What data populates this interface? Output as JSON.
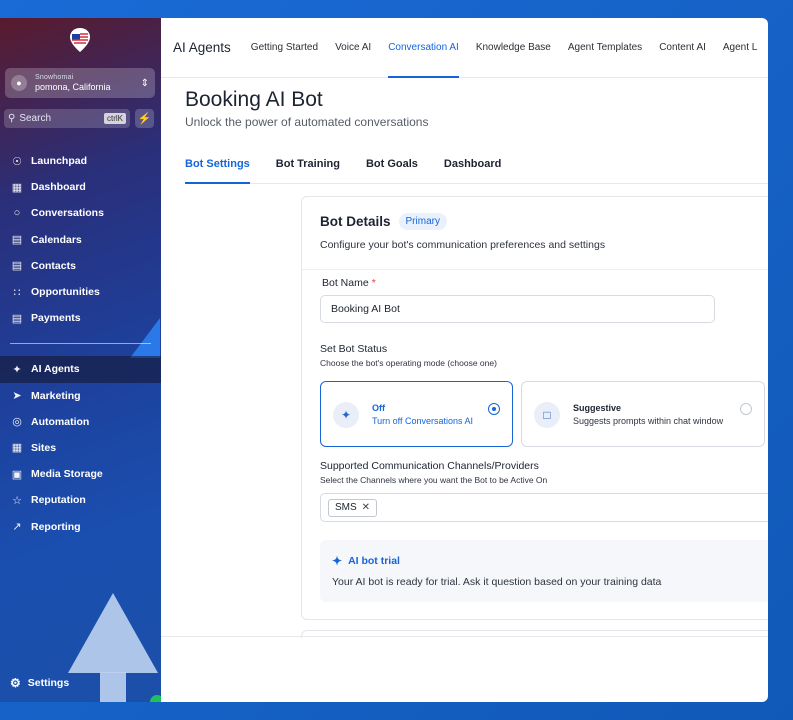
{
  "colors": {
    "accent": "#1565d8",
    "required": "#e23a3a"
  },
  "sidebar": {
    "location_name": "Snowhomai",
    "location_city": "pomona, California",
    "search_placeholder": "Search",
    "search_shortcut": "ctrlK",
    "items": [
      {
        "label": "Launchpad",
        "icon": "rocket-icon"
      },
      {
        "label": "Dashboard",
        "icon": "grid-icon"
      },
      {
        "label": "Conversations",
        "icon": "chat-icon"
      },
      {
        "label": "Calendars",
        "icon": "calendar-icon"
      },
      {
        "label": "Contacts",
        "icon": "contacts-icon"
      },
      {
        "label": "Opportunities",
        "icon": "network-icon"
      },
      {
        "label": "Payments",
        "icon": "payments-icon"
      }
    ],
    "items2": [
      {
        "label": "AI Agents",
        "icon": "sparkle-icon"
      },
      {
        "label": "Marketing",
        "icon": "send-icon"
      },
      {
        "label": "Automation",
        "icon": "automation-icon"
      },
      {
        "label": "Sites",
        "icon": "sites-icon"
      },
      {
        "label": "Media Storage",
        "icon": "image-icon"
      },
      {
        "label": "Reputation",
        "icon": "star-icon"
      },
      {
        "label": "Reporting",
        "icon": "chart-icon"
      }
    ],
    "settings_label": "Settings"
  },
  "topbar": {
    "brand": "AI Agents",
    "nav": [
      "Getting Started",
      "Voice AI",
      "Conversation AI",
      "Knowledge Base",
      "Agent Templates",
      "Content AI",
      "Agent L"
    ]
  },
  "page": {
    "title": "Booking AI Bot",
    "subtitle": "Unlock the power of automated conversations"
  },
  "tabs": [
    "Bot Settings",
    "Bot Training",
    "Bot Goals",
    "Dashboard"
  ],
  "card": {
    "title": "Bot Details",
    "badge": "Primary",
    "description": "Configure your bot's communication preferences and settings",
    "name_label": "Bot Name",
    "name_required": "*",
    "name_value": "Booking AI Bot",
    "status_label": "Set Bot Status",
    "status_hint": "Choose the bot's operating mode (choose one)",
    "options": [
      {
        "title": "Off",
        "desc": "Turn off Conversations AI",
        "selected": true
      },
      {
        "title": "Suggestive",
        "desc": "Suggests prompts within chat window",
        "selected": false
      }
    ],
    "channels_label": "Supported Communication Channels/Providers",
    "channels_hint": "Select the Channels where you want the Bot to be Active On",
    "channels": [
      "SMS"
    ],
    "trial_title": "AI bot trial",
    "trial_body": "Your AI bot is ready for trial. Ask it question based on your training data"
  }
}
